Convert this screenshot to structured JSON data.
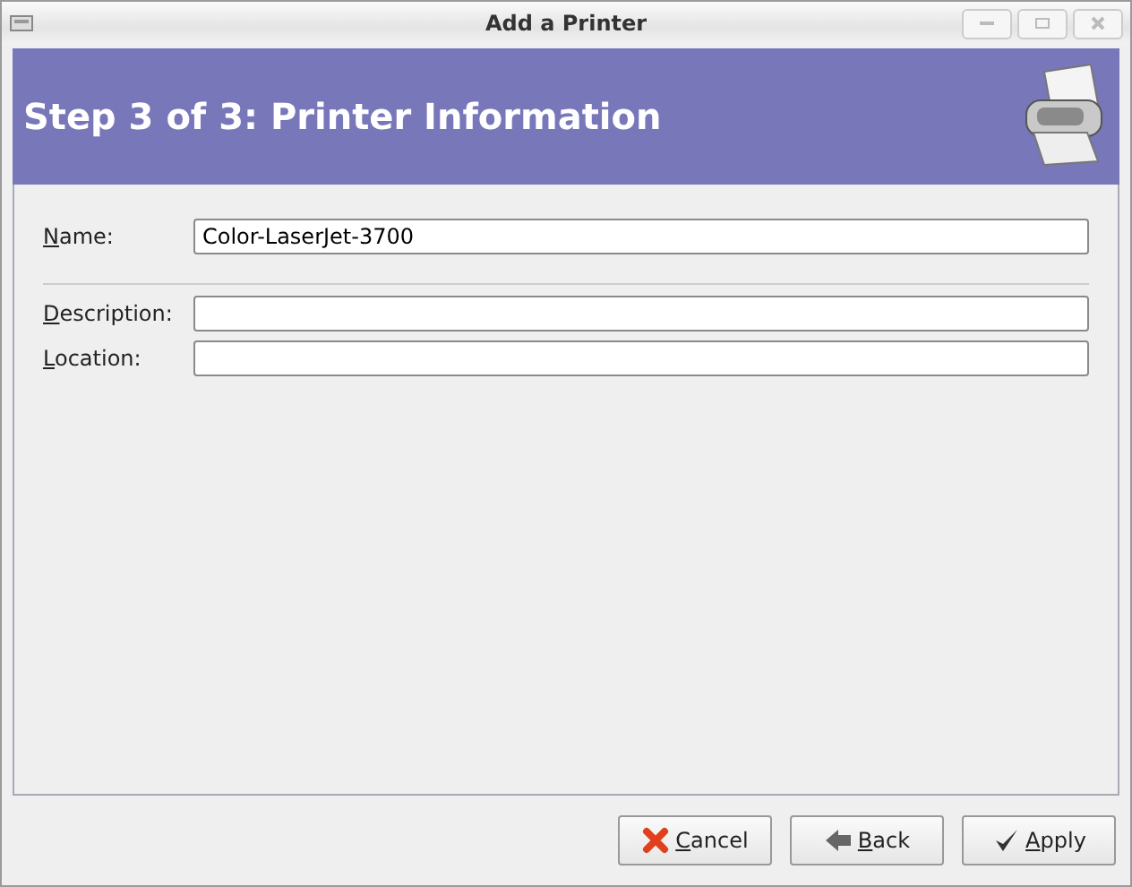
{
  "window": {
    "title": "Add a Printer"
  },
  "header": {
    "title": "Step 3 of 3: Printer Information"
  },
  "field_groups": [
    [
      {
        "label": "Name:",
        "value": "Color-LaserJet-3700"
      }
    ],
    [
      {
        "label": "Description:"
      },
      {
        "label": "Location:"
      }
    ]
  ],
  "buttons": [
    {
      "kind": "cancel",
      "label": "Cancel"
    },
    {
      "kind": "back",
      "label": "Back"
    },
    {
      "kind": "apply",
      "label": "Apply"
    }
  ]
}
